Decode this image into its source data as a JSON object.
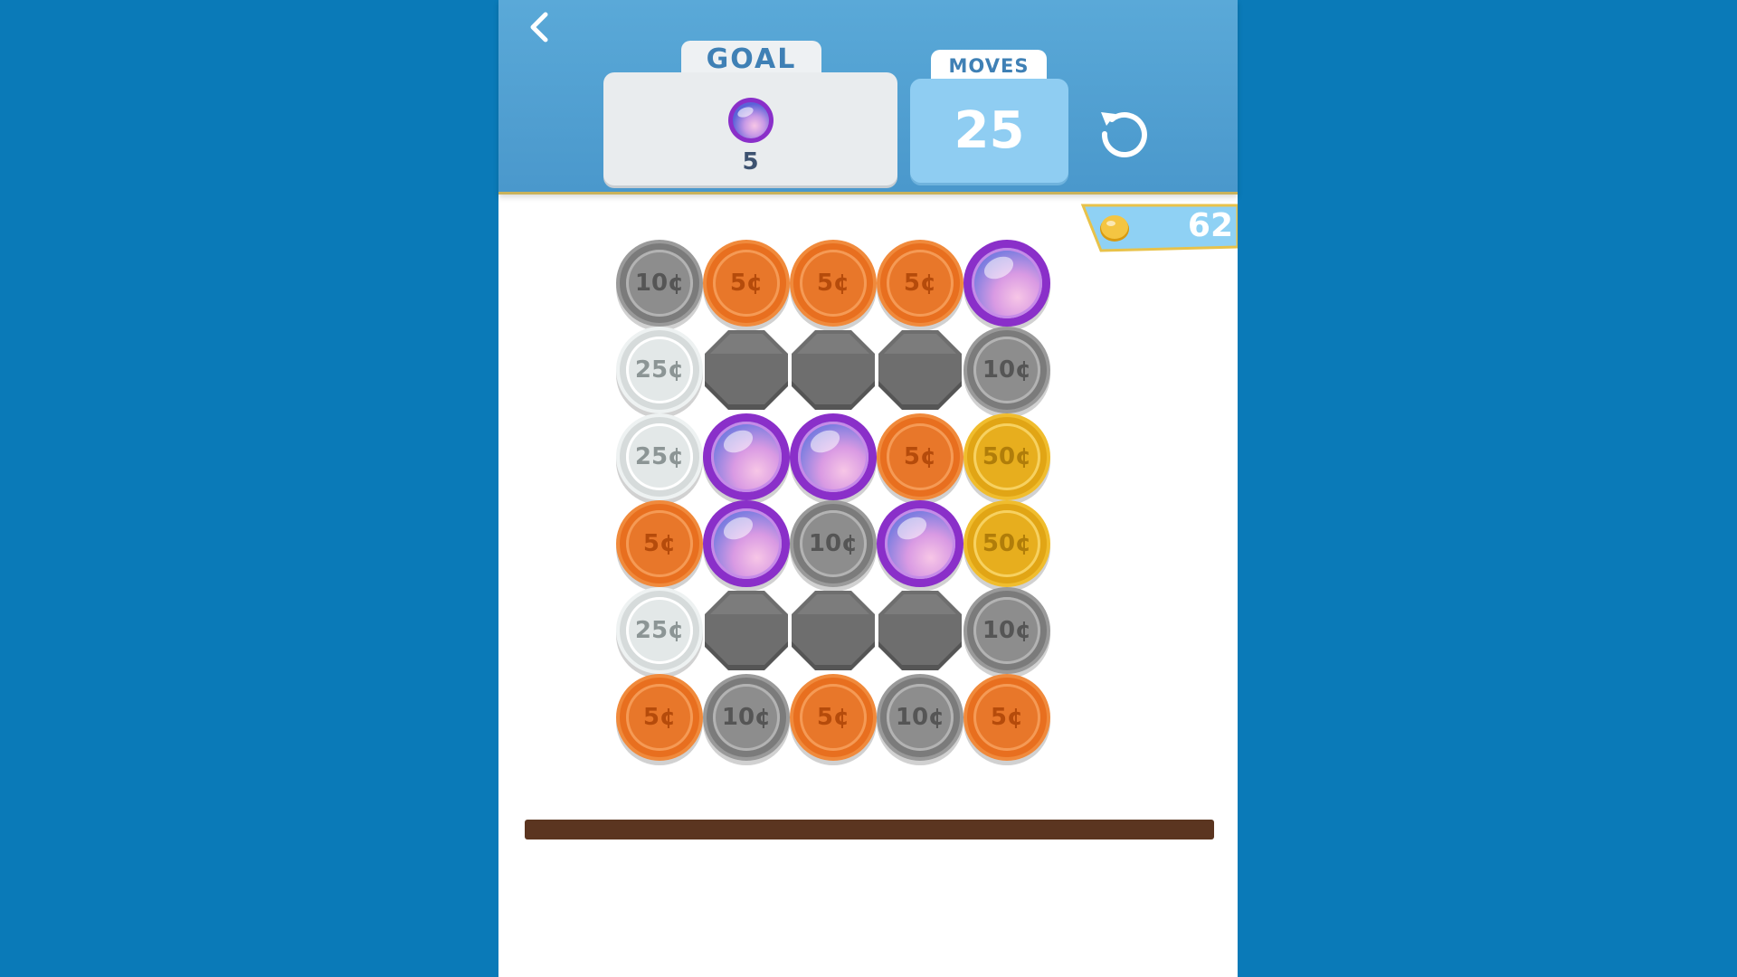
{
  "header": {
    "goal_label": "GOAL",
    "goal_target_icon": "gem-icon",
    "goal_count": "5",
    "moves_label": "MOVES",
    "moves_value": "25",
    "back_icon": "chevron-left-icon",
    "restart_icon": "restart-icon"
  },
  "coins": {
    "icon": "coin-icon",
    "value": "62"
  },
  "board": {
    "rows": 6,
    "cols": 5,
    "cells": [
      [
        "10¢",
        "5¢",
        "5¢",
        "5¢",
        "gem"
      ],
      [
        "25¢",
        "block",
        "block",
        "block",
        "10¢"
      ],
      [
        "25¢",
        "gem",
        "gem",
        "5¢",
        "50¢"
      ],
      [
        "5¢",
        "gem",
        "10¢",
        "gem",
        "50¢"
      ],
      [
        "25¢",
        "block",
        "block",
        "block",
        "10¢"
      ],
      [
        "5¢",
        "10¢",
        "5¢",
        "10¢",
        "5¢"
      ]
    ]
  },
  "colors": {
    "background": "#0a7ab8",
    "header": "#4a98cc",
    "coin_5": "#e86f1f",
    "coin_10": "#7b7b7b",
    "coin_25": "#d6dbdb",
    "coin_50": "#e1a515",
    "gem": "#8a2fc9",
    "blocker": "#6e6e6e",
    "bar": "#5b3520"
  }
}
